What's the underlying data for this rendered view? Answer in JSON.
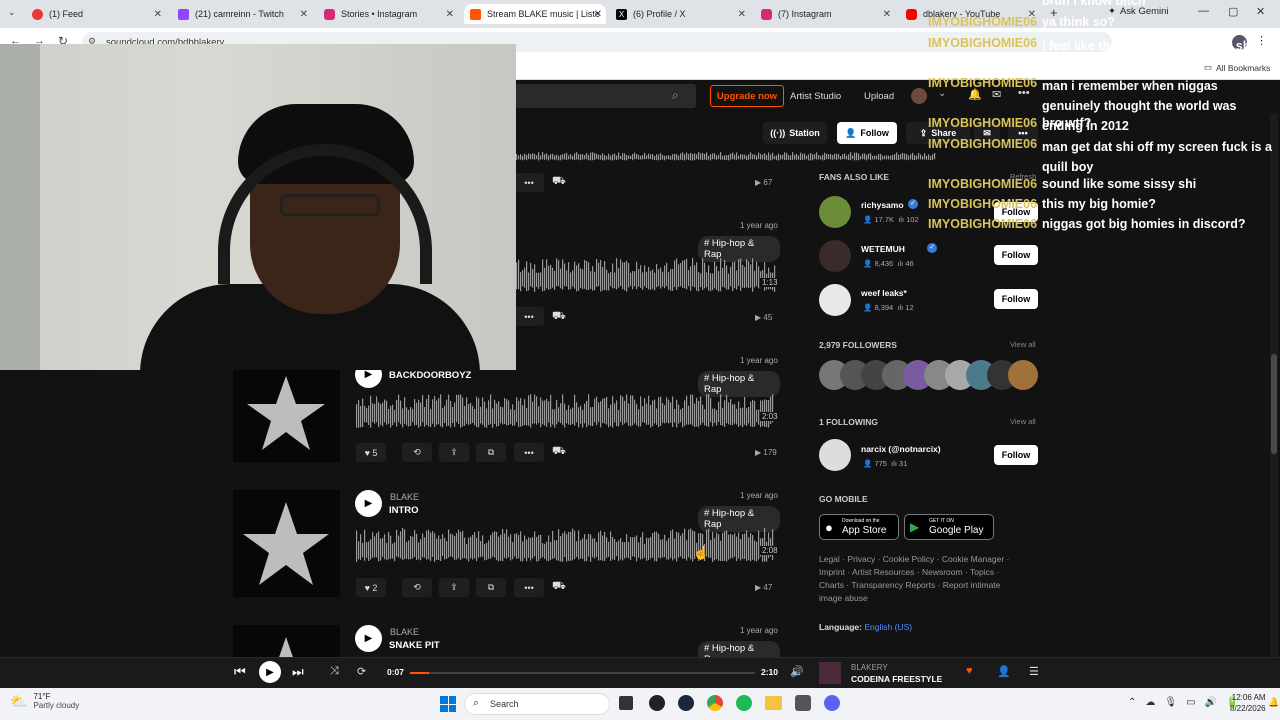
{
  "browser": {
    "tabs": [
      {
        "label": "(1) Feed",
        "color": "#e53935"
      },
      {
        "label": "(21) camreinn - Twitch",
        "color": "#9146ff"
      },
      {
        "label": "Stories • Instagram",
        "color": "#d62976"
      },
      {
        "label": "Stream BLAKE music | Liste",
        "color": "#ff5500"
      },
      {
        "label": "(6) Profile / X",
        "color": "#000000"
      },
      {
        "label": "(7) Instagram",
        "color": "#d62976"
      },
      {
        "label": "dblakery - YouTube",
        "color": "#ff0000"
      }
    ],
    "url": "soundcloud.com/bdbblakery",
    "ask_gemini": "Ask Gemini",
    "all_bookmarks": "All Bookmarks"
  },
  "header": {
    "upgrade": "Upgrade now",
    "artist_studio": "Artist Studio",
    "upload": "Upload"
  },
  "profile_actions": {
    "station": "Station",
    "follow": "Follow",
    "share": "Share"
  },
  "tracks": [
    {
      "artist": "",
      "title": "",
      "date": "",
      "genre": "",
      "plays": "67",
      "likes": "",
      "duration": ""
    },
    {
      "artist": "",
      "title": "",
      "date": "1 year ago",
      "genre": "# Hip-hop & Rap",
      "plays": "45",
      "likes": "",
      "duration": "1:13"
    },
    {
      "artist": "",
      "title": "BACKDOORBOYZ",
      "date": "1 year ago",
      "genre": "# Hip-hop & Rap",
      "plays": "179",
      "likes": "5",
      "duration": "2:03"
    },
    {
      "artist": "BLAKE",
      "title": "INTRO",
      "date": "1 year ago",
      "genre": "# Hip-hop & Rap",
      "plays": "47",
      "likes": "2",
      "duration": "2:08"
    },
    {
      "artist": "BLAKE",
      "title": "SNAKE PIT",
      "date": "1 year ago",
      "genre": "# Hip-hop & Rap",
      "plays": "",
      "likes": "",
      "duration": ""
    }
  ],
  "sidebar": {
    "fans_title": "FANS ALSO LIKE",
    "refresh": "Refresh",
    "fans": [
      {
        "name": "richysamo",
        "followers": "17.7K",
        "tracks": "102",
        "follow": "Follow"
      },
      {
        "name": "WETEMUH",
        "followers": "8,436",
        "tracks": "46",
        "follow": "Follow"
      },
      {
        "name": "weef leaks*",
        "followers": "8,394",
        "tracks": "12",
        "follow": "Follow"
      }
    ],
    "followers_title": "2,979 FOLLOWERS",
    "view_all": "View all",
    "following_title": "1 FOLLOWING",
    "following": {
      "name": "narcix (@notnarcix)",
      "followers": "775",
      "tracks": "31",
      "follow": "Follow"
    },
    "go_mobile": "GO MOBILE",
    "app_store_small": "Download on the",
    "app_store": "App Store",
    "google_small": "GET IT ON",
    "google_play": "Google Play",
    "footer_links": "Legal · Privacy · Cookie Policy · Cookie Manager · Imprint · Artist Resources · Newsroom · Topics · Charts · Transparency Reports · Report intimate image abuse",
    "language_label": "Language:",
    "language_value": "English (US)"
  },
  "player": {
    "elapsed": "0:07",
    "total": "2:10",
    "artist": "BLAKERY",
    "title": "CODEINA FREESTYLE",
    "progress": 0.054
  },
  "chat": [
    {
      "name": "",
      "msg": "bruh i know bitch"
    },
    {
      "name": "IMYOBIGHOMIE06",
      "msg": "ya think so?"
    },
    {
      "name": "IMYOBIGHOMIE06",
      "msg": "i feel like they gon be some new shi to come around"
    },
    {
      "name": "IMYOBIGHOMIE06",
      "msg": "man i remember when niggas genuinely thought the world was ending in 2012"
    },
    {
      "name": "IMYOBIGHOMIE06",
      "msg": "bro wtf?"
    },
    {
      "name": "IMYOBIGHOMIE06",
      "msg": "man get dat shi off my screen fuck is a quill boy"
    },
    {
      "name": "IMYOBIGHOMIE06",
      "msg": "sound like some sissy shi"
    },
    {
      "name": "IMYOBIGHOMIE06",
      "msg": "this my big homie?"
    },
    {
      "name": "IMYOBIGHOMIE06",
      "msg": "niggas got big homies in discord?"
    }
  ],
  "taskbar": {
    "temp": "71°F",
    "weather": "Partly cloudy",
    "search": "Search",
    "time": "12:06 AM",
    "date": "8/22/2026"
  }
}
